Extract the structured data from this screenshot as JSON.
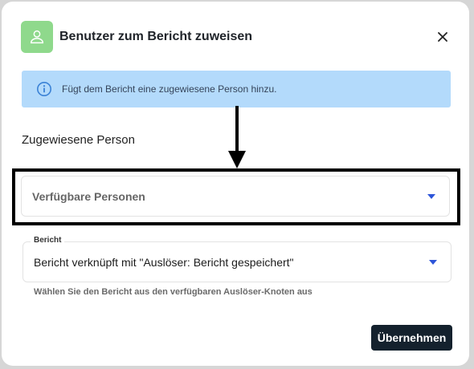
{
  "dialog": {
    "title": "Benutzer zum Bericht zuweisen",
    "avatar_icon": "user-icon",
    "close_icon": "close-icon",
    "info": {
      "icon": "info-icon",
      "text": "Fügt dem Bericht eine zugewiesene Person hinzu."
    },
    "section_title": "Zugewiesene Person",
    "persons_select": {
      "placeholder": "Verfügbare Personen"
    },
    "report_select": {
      "label": "Bericht",
      "value": "Bericht verknüpft mit \"Auslöser: Bericht gespeichert\"",
      "helper": "Wählen Sie den Bericht aus den verfügbaren Auslöser-Knoten aus"
    },
    "apply_label": "Übernehmen"
  },
  "colors": {
    "avatar_bg": "#8fd98c",
    "info_bg": "#b3dafb",
    "info_icon": "#3b82d6",
    "caret": "#2d55d9",
    "button_bg": "#14212d"
  }
}
